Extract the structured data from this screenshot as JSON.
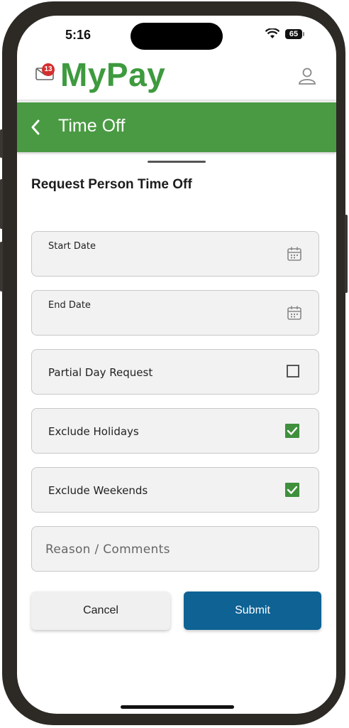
{
  "status_bar": {
    "time": "5:16",
    "battery": "65"
  },
  "header": {
    "logo": "MyPay",
    "mail_badge": "13"
  },
  "title_bar": {
    "title": "Time Off"
  },
  "form": {
    "heading": "Request Person Time Off",
    "start_date_label": "Start Date",
    "end_date_label": "End Date",
    "partial_day_label": "Partial Day Request",
    "partial_day_checked": false,
    "exclude_holidays_label": "Exclude Holidays",
    "exclude_holidays_checked": true,
    "exclude_weekends_label": "Exclude Weekends",
    "exclude_weekends_checked": true,
    "reason_placeholder": "Reason / Comments"
  },
  "actions": {
    "cancel_label": "Cancel",
    "submit_label": "Submit"
  },
  "colors": {
    "brand_green": "#3e9a3e",
    "title_bar": "#4a9a43",
    "submit_blue": "#0e6294",
    "badge_red": "#d32f2f"
  }
}
